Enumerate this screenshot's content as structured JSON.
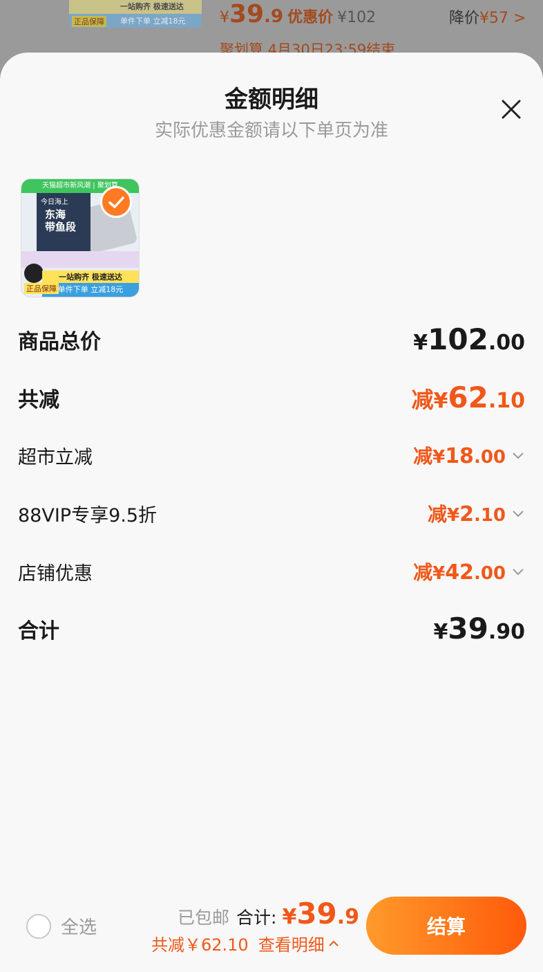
{
  "background": {
    "thumb_line1": "一站购齐 极速送达",
    "thumb_line2": "单件下单 立减18元",
    "thumb_badge": "正品保障",
    "price_currency": "¥",
    "price_int": "39",
    "price_dec": ".9",
    "price_label": "优惠价",
    "orig_price": "¥102",
    "drop_label": "降价",
    "drop_value": "¥57",
    "drop_chevron": ">",
    "timer": "聚划算 4月30日23:59结束"
  },
  "sheet": {
    "title": "金额明细",
    "subtitle": "实际优惠金额请以下单页为准"
  },
  "product": {
    "banner": "天猫超市新风潮 | 聚划算",
    "brand": "今日海上",
    "name": "东海\n带鱼段",
    "promo1": "一站购齐 极速送达",
    "promo2": "单件下单 立减18元",
    "badge": "正品保障"
  },
  "rows": [
    {
      "label": "商品总价",
      "prefix": "",
      "currency": "¥",
      "int": "102",
      "dec": ".00"
    },
    {
      "label": "共减",
      "prefix": "减",
      "currency": "¥",
      "int": "62",
      "dec": ".10"
    },
    {
      "label": "超市立减",
      "prefix": "减",
      "currency": "¥",
      "int": "18",
      "dec": ".00"
    },
    {
      "label": "88VIP专享9.5折",
      "prefix": "减",
      "currency": "¥",
      "int": "2",
      "dec": ".10"
    },
    {
      "label": "店铺优惠",
      "prefix": "减",
      "currency": "¥",
      "int": "42",
      "dec": ".00"
    },
    {
      "label": "合计",
      "prefix": "",
      "currency": "¥",
      "int": "39",
      "dec": ".90"
    }
  ],
  "bottom": {
    "select_all": "全选",
    "shipping": "已包邮",
    "total_label": "合计:",
    "total_currency": "¥",
    "total_int": "39",
    "total_dec": ".9",
    "savings": "共减￥62.10",
    "view_detail": "查看明细",
    "checkout": "结算"
  },
  "colors": {
    "accent": "#f0581a",
    "button_start": "#ff9a2b",
    "button_end": "#ff5a0a",
    "sheet_bg": "#f8f8f8"
  }
}
